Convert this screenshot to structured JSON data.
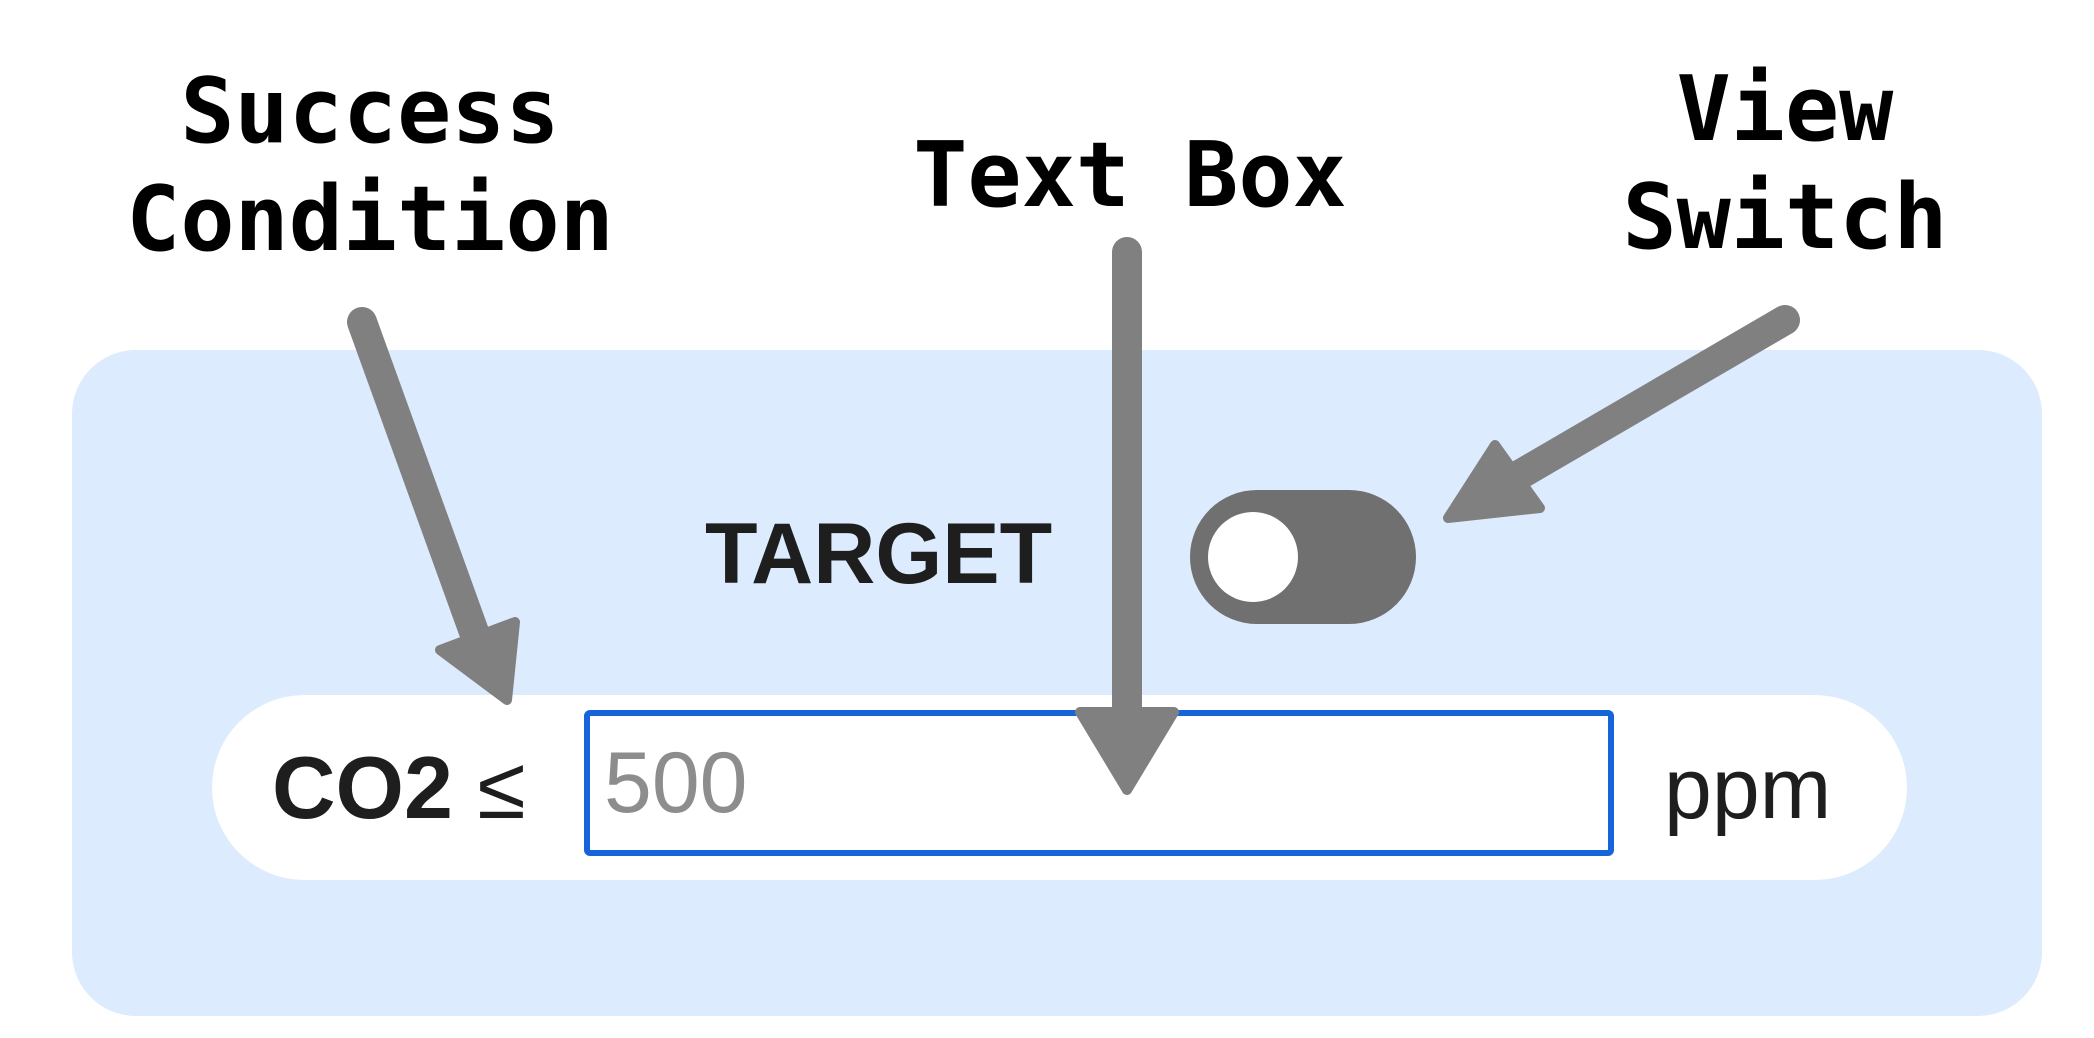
{
  "annotations": {
    "success_condition": [
      "Success",
      "Condition"
    ],
    "text_box": [
      "Text Box"
    ],
    "view_switch": [
      "View",
      "Switch"
    ]
  },
  "panel": {
    "target_label": "TARGET",
    "toggle_state": "off",
    "condition": {
      "metric": "CO2",
      "operator": "≤",
      "input_value": "",
      "input_placeholder": "500",
      "unit": "ppm"
    }
  },
  "colors": {
    "panel_background": "#dcebfd",
    "toggle_track": "#707070",
    "input_border": "#1565d8",
    "arrow": "#808080"
  }
}
